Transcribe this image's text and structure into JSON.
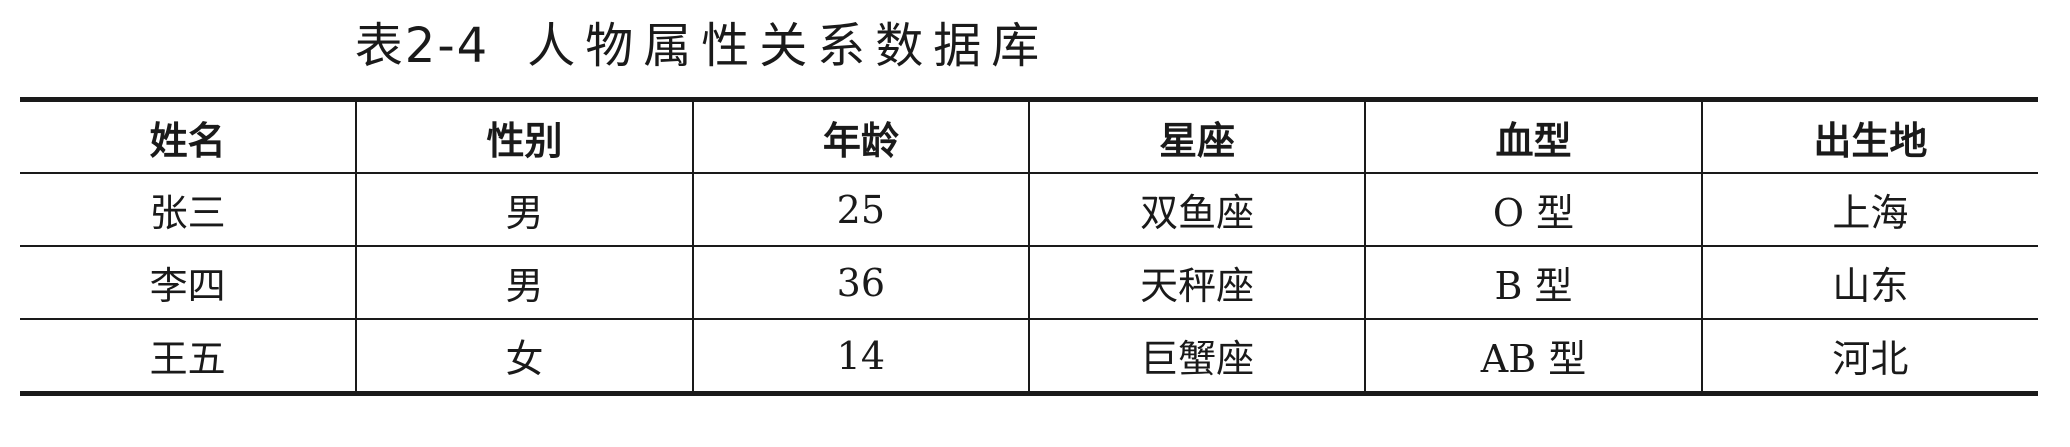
{
  "caption": {
    "number": "表2-4",
    "title": "人物属性关系数据库"
  },
  "table": {
    "headers": [
      "姓名",
      "性别",
      "年龄",
      "星座",
      "血型",
      "出生地"
    ],
    "rows": [
      [
        "张三",
        "男",
        "25",
        "双鱼座",
        "O 型",
        "上海"
      ],
      [
        "李四",
        "男",
        "36",
        "天秤座",
        "B 型",
        "山东"
      ],
      [
        "王五",
        "女",
        "14",
        "巨蟹座",
        "AB 型",
        "河北"
      ]
    ]
  }
}
